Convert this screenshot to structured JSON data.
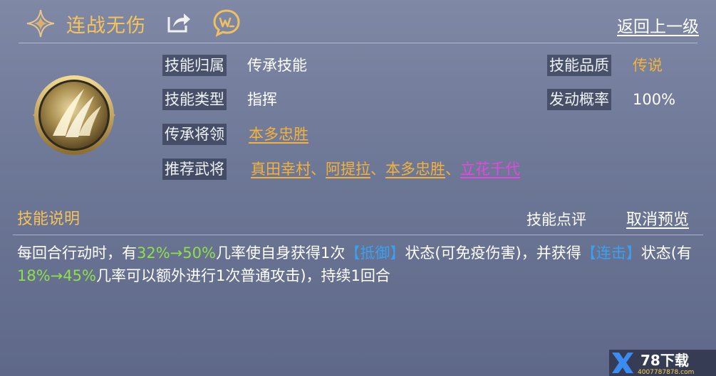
{
  "header": {
    "title": "连战无伤",
    "back_label": "返回上一级"
  },
  "info": {
    "owner_label": "技能归属",
    "owner_value": "传承技能",
    "type_label": "技能类型",
    "type_value": "指挥",
    "inherit_label": "传承将领",
    "inherit_value": "本多忠胜",
    "recommend_label": "推荐武将",
    "recommend": [
      {
        "name": "真田幸村",
        "color": "#f4b23a"
      },
      {
        "name": "阿提拉",
        "color": "#f4b23a"
      },
      {
        "name": "本多忠胜",
        "color": "#f4b23a"
      },
      {
        "name": "立花千代",
        "color": "#e548e0"
      }
    ],
    "separator": "、",
    "quality_label": "技能品质",
    "quality_value": "传说",
    "chance_label": "发动概率",
    "chance_value": "100%"
  },
  "section": {
    "title": "技能说明",
    "comment_label": "技能点评",
    "cancel_label": "取消预览"
  },
  "description": {
    "p1": "每回合行动时，有",
    "r1": "32%→50%",
    "p2": "几率使自身获得1次",
    "s1": "【抵御】",
    "p3": "状态(可免疫伤害)，并获得",
    "s2": "【连击】",
    "p4": "状态(有",
    "r2": "18%→45%",
    "p5": "几率可以额外进行1次普通攻击)，持续1回合"
  },
  "watermark": {
    "brand": "78下载",
    "phone": "4007787878.com"
  },
  "colors": {
    "gold": "#f4b23a",
    "green": "#8ee04a",
    "blue": "#3aa0f0",
    "pink": "#e548e0"
  },
  "icons": [
    "sparkle-star-icon",
    "share-icon",
    "w-chat-icon",
    "skill-badge-icon"
  ]
}
